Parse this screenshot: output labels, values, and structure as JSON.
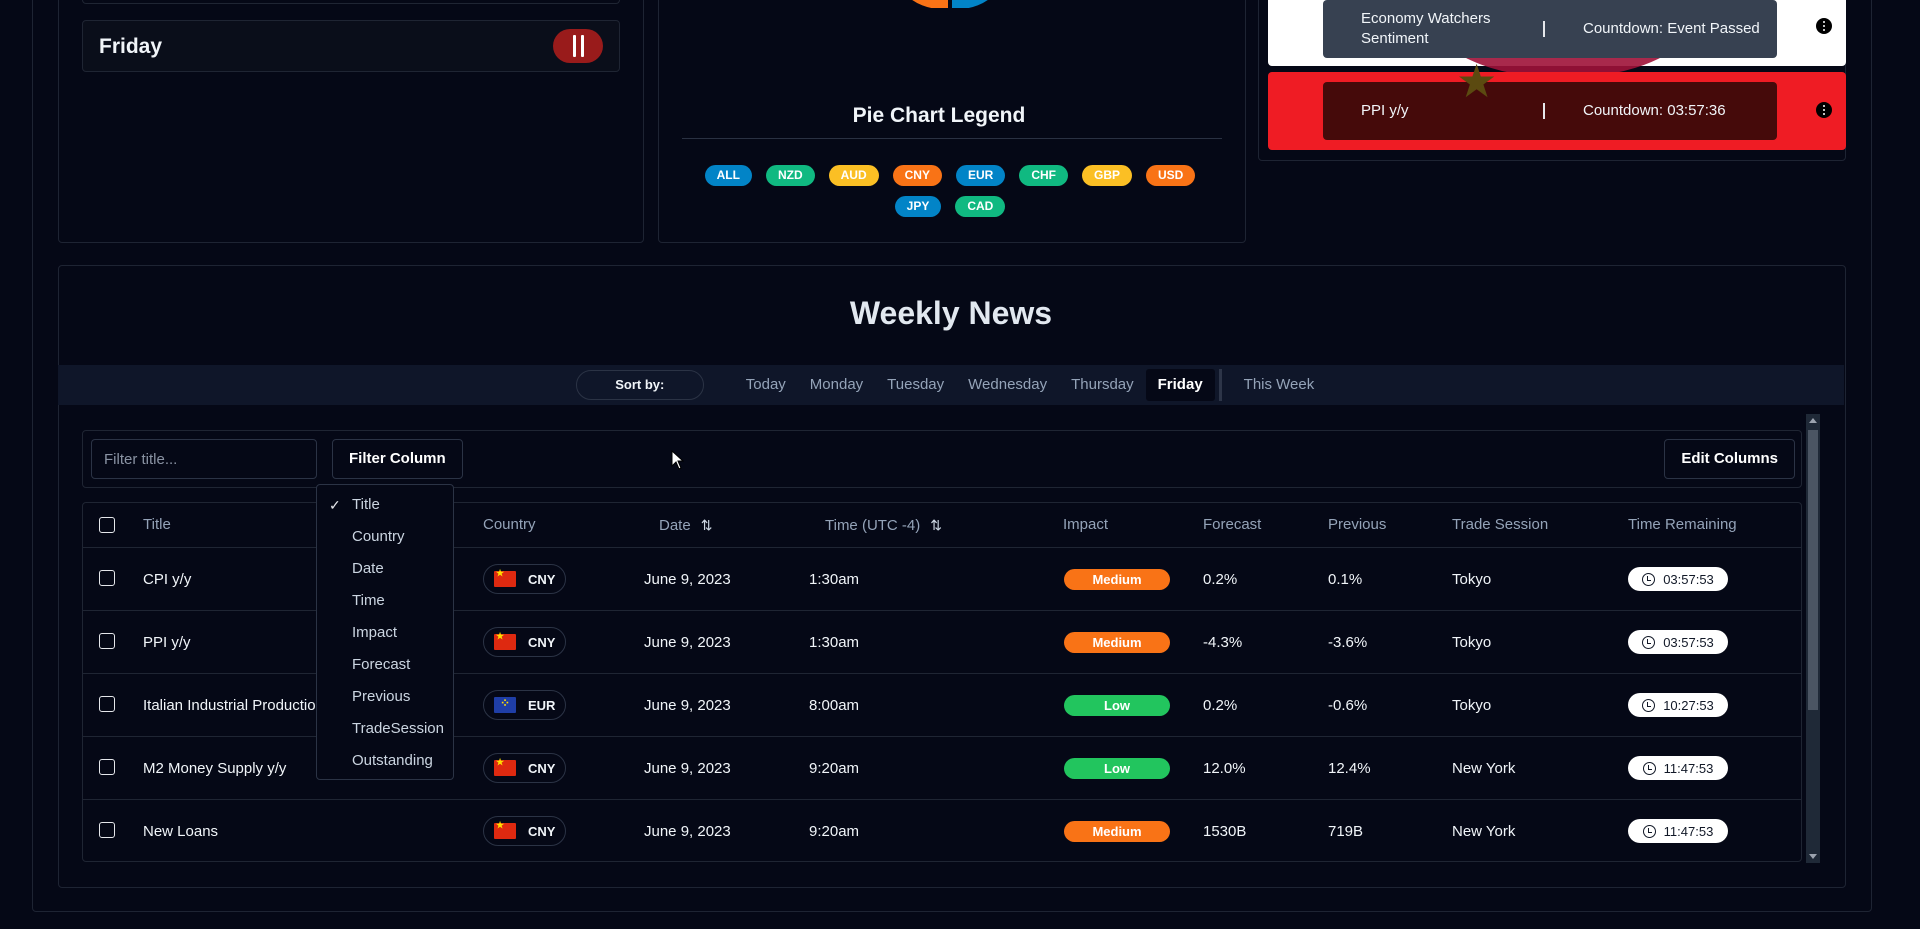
{
  "day_panel": {
    "day_label": "Friday",
    "pause_label": "Pause"
  },
  "pie_legend": {
    "title": "Pie Chart Legend",
    "chips": [
      {
        "label": "ALL",
        "color": "#0284c7"
      },
      {
        "label": "NZD",
        "color": "#10b981"
      },
      {
        "label": "AUD",
        "color": "#fbbf24"
      },
      {
        "label": "CNY",
        "color": "#f97316"
      },
      {
        "label": "EUR",
        "color": "#0284c7"
      },
      {
        "label": "CHF",
        "color": "#10b981"
      },
      {
        "label": "GBP",
        "color": "#fbbf24"
      },
      {
        "label": "USD",
        "color": "#f97316"
      },
      {
        "label": "JPY",
        "color": "#0284c7"
      },
      {
        "label": "CAD",
        "color": "#10b981"
      }
    ]
  },
  "events": [
    {
      "title": "Economy Watchers Sentiment",
      "countdown": "Countdown: Event Passed"
    },
    {
      "title": "PPI y/y",
      "countdown": "Countdown: 03:57:36"
    }
  ],
  "weekly_news": {
    "title": "Weekly News",
    "sort_by": "Sort by:",
    "tabs": [
      "Today",
      "Monday",
      "Tuesday",
      "Wednesday",
      "Thursday",
      "Friday",
      "This Week"
    ],
    "active_tab": "Friday",
    "filter_placeholder": "Filter title...",
    "filter_column_label": "Filter Column",
    "edit_columns_label": "Edit Columns",
    "columns": {
      "title": "Title",
      "country": "Country",
      "date": "Date",
      "time": "Time (UTC -4)",
      "impact": "Impact",
      "forecast": "Forecast",
      "previous": "Previous",
      "trade_session": "Trade Session",
      "time_remaining": "Time Remaining"
    },
    "rows": [
      {
        "title": "CPI y/y",
        "country": "CNY",
        "flag": "cn",
        "date": "June 9, 2023",
        "time": "1:30am",
        "impact": "Medium",
        "forecast": "0.2%",
        "previous": "0.1%",
        "session": "Tokyo",
        "remaining": "03:57:53"
      },
      {
        "title": "PPI y/y",
        "country": "CNY",
        "flag": "cn",
        "date": "June 9, 2023",
        "time": "1:30am",
        "impact": "Medium",
        "forecast": "-4.3%",
        "previous": "-3.6%",
        "session": "Tokyo",
        "remaining": "03:57:53"
      },
      {
        "title": "Italian Industrial Productio",
        "country": "EUR",
        "flag": "eu",
        "date": "June 9, 2023",
        "time": "8:00am",
        "impact": "Low",
        "forecast": "0.2%",
        "previous": "-0.6%",
        "session": "Tokyo",
        "remaining": "10:27:53"
      },
      {
        "title": "M2 Money Supply y/y",
        "country": "CNY",
        "flag": "cn",
        "date": "June 9, 2023",
        "time": "9:20am",
        "impact": "Low",
        "forecast": "12.0%",
        "previous": "12.4%",
        "session": "New York",
        "remaining": "11:47:53"
      },
      {
        "title": "New Loans",
        "country": "CNY",
        "flag": "cn",
        "date": "June 9, 2023",
        "time": "9:20am",
        "impact": "Medium",
        "forecast": "1530B",
        "previous": "719B",
        "session": "New York",
        "remaining": "11:47:53"
      }
    ],
    "impact_colors": {
      "Medium": "#f97316",
      "Low": "#22c55e"
    },
    "filter_column_options": [
      "Title",
      "Country",
      "Date",
      "Time",
      "Impact",
      "Forecast",
      "Previous",
      "TradeSession",
      "Outstanding"
    ],
    "filter_column_selected": "Title"
  }
}
